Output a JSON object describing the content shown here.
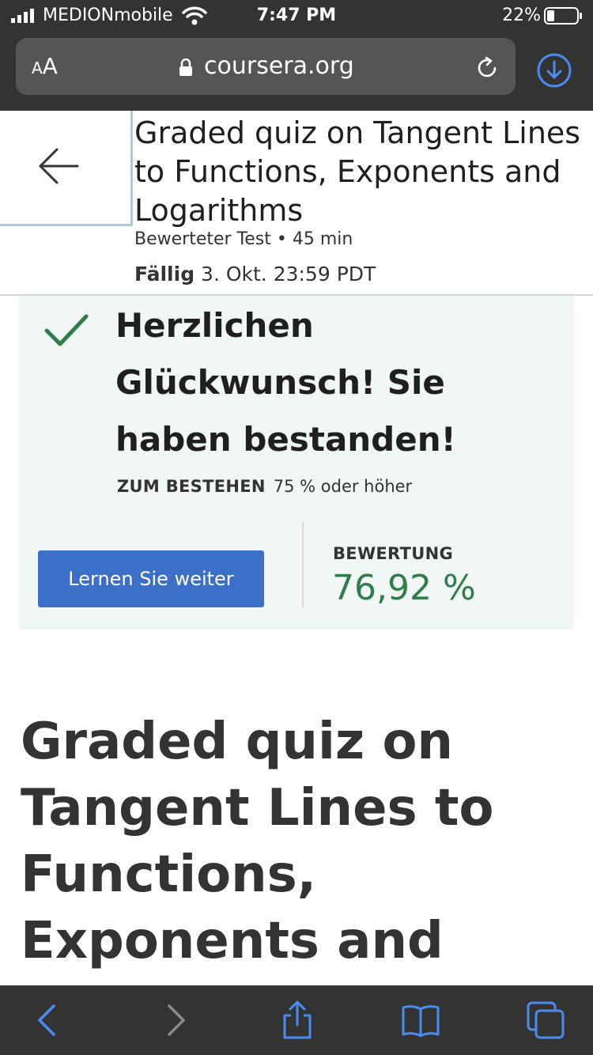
{
  "status_bar": {
    "carrier": "MEDIONmobile",
    "time": "7:47 PM",
    "battery": "22%"
  },
  "browser": {
    "text_size_label_small": "A",
    "text_size_label_large": "A",
    "url": "coursera.org",
    "icons": [
      "signal-icon",
      "wifi-icon",
      "battery-icon",
      "lock-icon",
      "reload-icon",
      "download-icon"
    ]
  },
  "header": {
    "title": "Graded quiz on Tangent Lines to Functions, Exponents and Logarithms",
    "meta": "Bewerteter Test • 45 min",
    "due_label": "Fällig",
    "due_value": "3. Okt. 23:59 PDT"
  },
  "result": {
    "headline": "Herzlichen Glückwunsch! Sie haben bestanden!",
    "pass_label": "ZUM BESTEHEN",
    "pass_value": "75 % oder höher",
    "continue_label": "Lernen Sie weiter",
    "grade_label": "BEWERTUNG",
    "grade_value": "76,92 %"
  },
  "main": {
    "title": "Graded quiz on Tangent Lines to Functions, Exponents and"
  },
  "toolbar": {
    "items": [
      "back-icon",
      "forward-icon",
      "share-icon",
      "bookmarks-icon",
      "tabs-icon"
    ]
  },
  "colors": {
    "chrome": "#333333",
    "accent_blue": "#3c6fc8",
    "success_green": "#2e7d4a",
    "card_background": "#f1f7f5"
  }
}
